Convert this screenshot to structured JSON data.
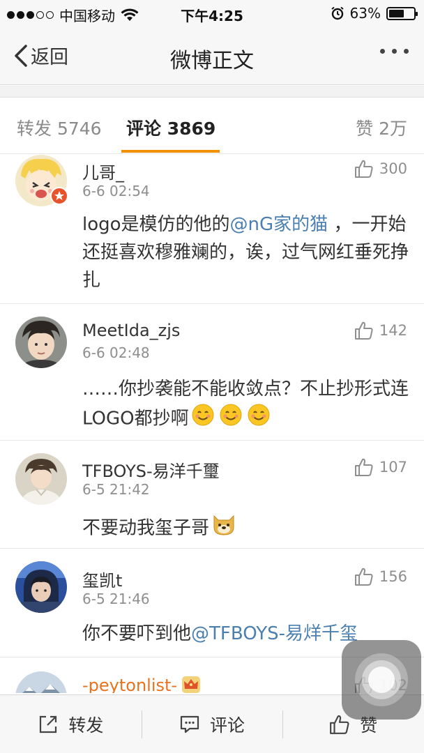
{
  "status_bar": {
    "carrier": "中国移动",
    "time": "下午4:25",
    "battery": "63%",
    "battery_level": 0.63,
    "signal_bars": 3
  },
  "nav": {
    "back_label": "返回",
    "title": "微博正文"
  },
  "tabs": {
    "repost": "转发 5746",
    "comment": "评论 3869",
    "like": "赞 2万"
  },
  "comments": [
    {
      "username": "儿哥_",
      "time": "6-6 02:54",
      "likes": "300",
      "content_before": "logo是模仿的他的",
      "mention": "@nG家的猫",
      "content_after": " ，一开始还挺喜欢穆雅斓的，诶，过气网红垂死挣扎"
    },
    {
      "username": "MeetIda_zjs",
      "time": "6-6 02:48",
      "likes": "142",
      "content": "……你抄袭能不能收敛点？不止抄形式连LOGO都抄啊"
    },
    {
      "username": "TFBOYS-易洋千璽",
      "time": "6-5 21:42",
      "likes": "107",
      "content": "不要动我玺子哥"
    },
    {
      "username": "玺凯t",
      "time": "6-5 21:46",
      "likes": "156",
      "content_before": "你不要吓到他",
      "mention": "@TFBOYS-易烊千玺"
    },
    {
      "username": "-peytonlist-",
      "likes": "102"
    }
  ],
  "toolbar": {
    "repost": "转发",
    "comment": "评论",
    "like": "赞"
  },
  "colors": {
    "accent": "#f29100",
    "mention": "#4a7fb0",
    "orange_username": "#e8731e"
  }
}
